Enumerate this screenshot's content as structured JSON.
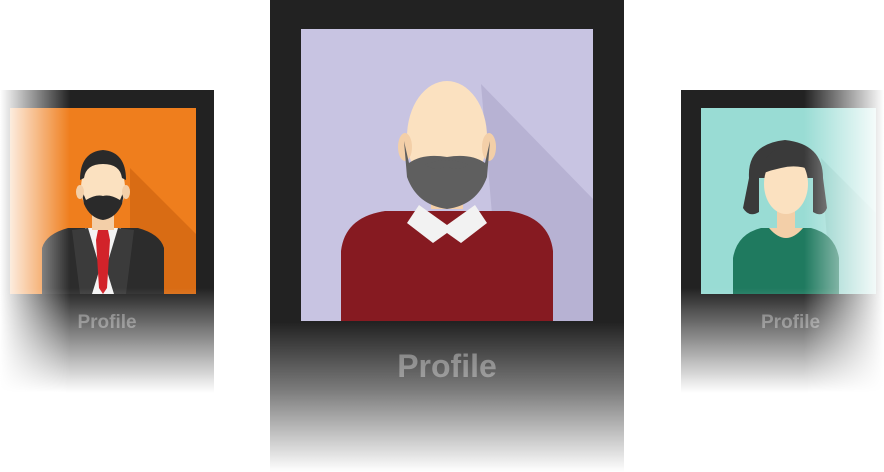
{
  "cards": [
    {
      "id": "left",
      "label": "Profile",
      "avatar": "businessman-avatar-icon",
      "background_color": "#EF7E1D"
    },
    {
      "id": "center",
      "label": "Profile",
      "avatar": "bearded-man-avatar-icon",
      "background_color": "#C8C4E2"
    },
    {
      "id": "right",
      "label": "Profile",
      "avatar": "woman-avatar-icon",
      "background_color": "#99DCD4"
    }
  ],
  "colors": {
    "card_frame": "#222222",
    "label_text": "#6A6A6A"
  }
}
